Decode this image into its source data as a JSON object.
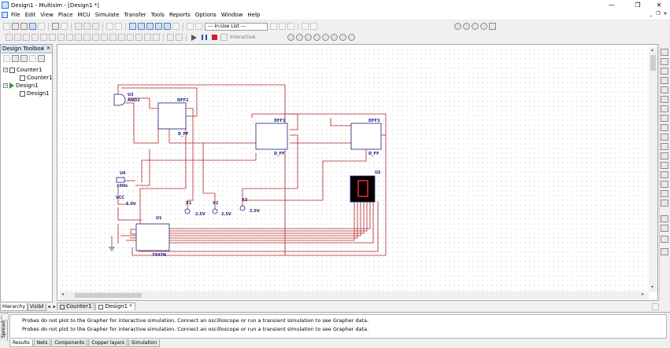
{
  "window": {
    "title": "Design1 - Multisim - [Design1 *]",
    "minimize": "—",
    "restore": "❐",
    "close": "✕"
  },
  "menu": [
    "File",
    "Edit",
    "View",
    "Place",
    "MCU",
    "Simulate",
    "Transfer",
    "Tools",
    "Reports",
    "Options",
    "Window",
    "Help"
  ],
  "toolbar": {
    "in_use_list": "--- In-Use List ---",
    "interactive_label": "Interactive"
  },
  "toolbox": {
    "title": "Design Toolbox",
    "pin": "⊥",
    "close": "✕",
    "tree": [
      {
        "label": "Counter1",
        "level": 0
      },
      {
        "label": "Counter1",
        "level": 1
      },
      {
        "label": "Design1",
        "level": 0
      },
      {
        "label": "Design1",
        "level": 1
      }
    ],
    "tabs": [
      "Hierarchy",
      "Visibil"
    ]
  },
  "doc_tabs": [
    "Counter1",
    "Design1 *"
  ],
  "schematic": {
    "u3_ref": "U3",
    "u3_type": "AND2",
    "dff2_ref": "DFF2",
    "dff2_type": "D_FF",
    "dff1_ref": "DFF1",
    "dff1_type": "D_FF",
    "dff3_ref": "DFF3",
    "dff3_type": "D_FF",
    "u4_ref": "U4",
    "u4_value": "10Hz",
    "vcc_ref": "VCC",
    "vcc_value": "5.0V",
    "u1_ref": "U1",
    "u1_type": "7447N",
    "u2_ref": "U2",
    "x1_ref": "X1",
    "x1_value": "2.5V",
    "x2_ref": "X2",
    "x2_value": "2.5V",
    "x3_ref": "X3",
    "x3_value": "2.5V"
  },
  "spreadsheet": {
    "side_label": "Spreadsh",
    "rows": [
      "Probes do not plot to the Grapher for interactive simulation. Connect an oscilloscope or run a transient simulation to see Grapher data.",
      "Probes do not plot to the Grapher for interactive simulation. Connect an oscilloscope or run a transient simulation to see Grapher data."
    ],
    "tabs": [
      "Results",
      "Nets",
      "Components",
      "Copper layers",
      "Simulation"
    ]
  },
  "colors": {
    "wire": "#b2262a",
    "component": "#1f1f80",
    "display_bg": "#000000",
    "segment": "#d61f26"
  }
}
